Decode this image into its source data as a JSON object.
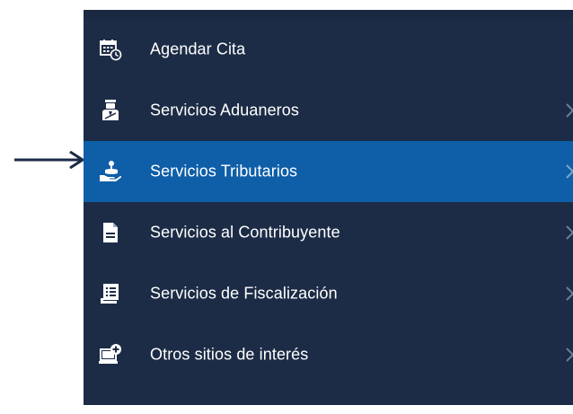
{
  "menu": {
    "items": [
      {
        "label": "Agendar Cita",
        "icon": "calendar-clock-icon",
        "has_submenu": false,
        "active": false
      },
      {
        "label": "Servicios Aduaneros",
        "icon": "customs-officer-icon",
        "has_submenu": true,
        "active": false
      },
      {
        "label": "Servicios Tributarios",
        "icon": "hand-coin-icon",
        "has_submenu": true,
        "active": true
      },
      {
        "label": "Servicios al Contribuyente",
        "icon": "document-icon",
        "has_submenu": true,
        "active": false
      },
      {
        "label": "Servicios de Fiscalización",
        "icon": "checklist-icon",
        "has_submenu": true,
        "active": false
      },
      {
        "label": "Otros sitios de interés",
        "icon": "monitor-add-icon",
        "has_submenu": true,
        "active": false
      }
    ]
  },
  "colors": {
    "menu_background": "#1c2c46",
    "active_background": "#0e5ea8",
    "text": "#ffffff",
    "pointer_arrow": "#1b2b46"
  }
}
